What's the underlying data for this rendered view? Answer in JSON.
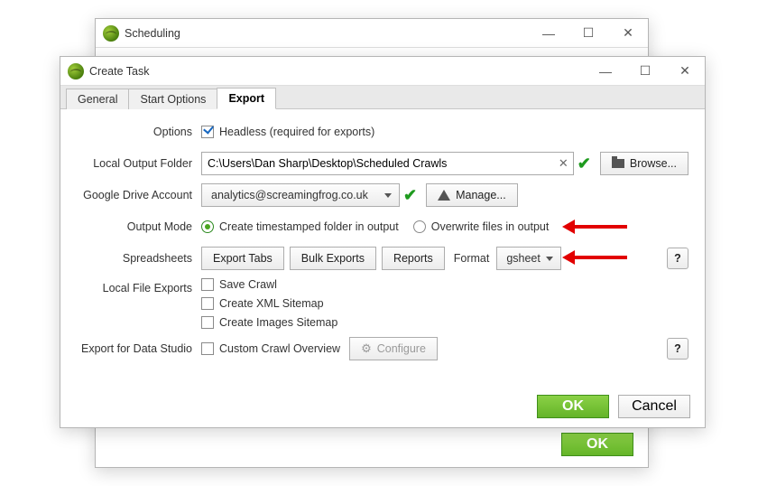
{
  "background_window": {
    "title": "Scheduling",
    "ok_label": "OK"
  },
  "window": {
    "title": "Create Task",
    "tabs": {
      "general": "General",
      "start_options": "Start Options",
      "export": "Export"
    }
  },
  "labels": {
    "options": "Options",
    "headless": "Headless (required for exports)",
    "local_output_folder": "Local Output Folder",
    "browse": "Browse...",
    "google_drive_account": "Google Drive Account",
    "manage": "Manage...",
    "output_mode": "Output Mode",
    "create_timestamped": "Create timestamped folder in output",
    "overwrite_files": "Overwrite files in output",
    "spreadsheets": "Spreadsheets",
    "export_tabs": "Export Tabs",
    "bulk_exports": "Bulk Exports",
    "reports": "Reports",
    "format": "Format",
    "local_file_exports": "Local File Exports",
    "save_crawl": "Save Crawl",
    "create_xml_sitemap": "Create XML Sitemap",
    "create_images_sitemap": "Create Images Sitemap",
    "export_data_studio": "Export for Data Studio",
    "custom_crawl_overview": "Custom Crawl Overview",
    "configure": "Configure",
    "ok": "OK",
    "cancel": "Cancel"
  },
  "values": {
    "local_output_folder": "C:\\Users\\Dan Sharp\\Desktop\\Scheduled Crawls",
    "google_account": "analytics@screamingfrog.co.uk",
    "format": "gsheet",
    "headless_checked": true,
    "output_mode": "timestamped",
    "save_crawl": false,
    "create_xml_sitemap": false,
    "create_images_sitemap": false,
    "custom_crawl_overview": false
  }
}
